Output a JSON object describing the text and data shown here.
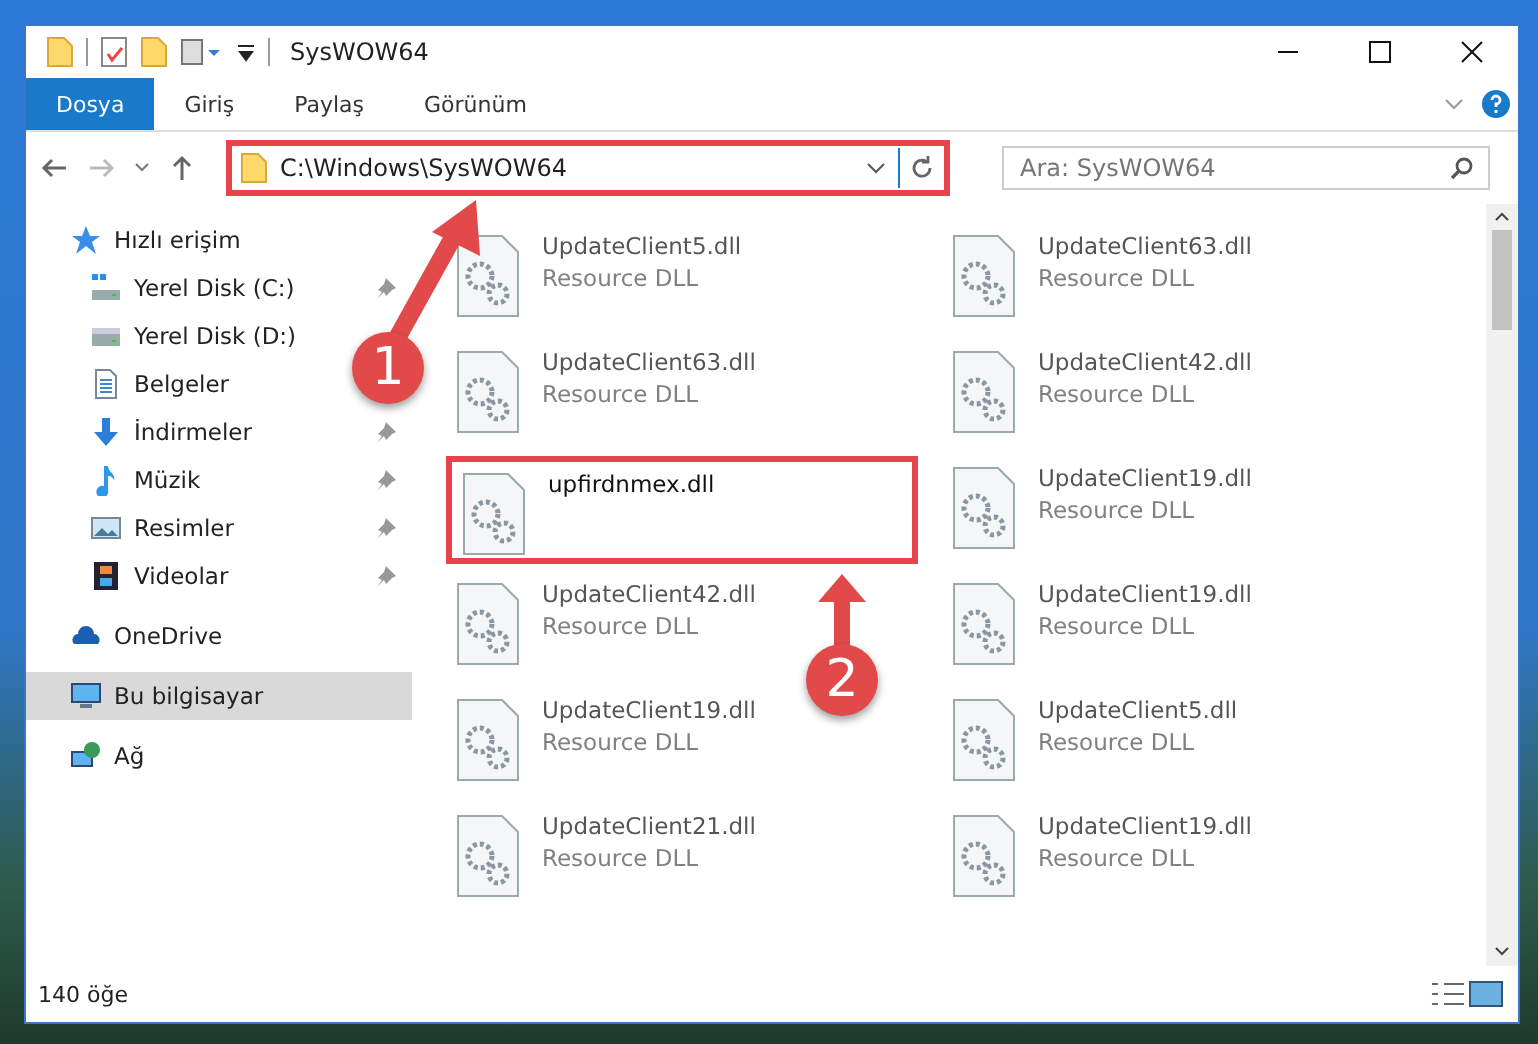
{
  "window": {
    "title": "SysWOW64"
  },
  "ribbon_tabs": [
    {
      "label": "Dosya",
      "selected": true
    },
    {
      "label": "Giriş",
      "selected": false
    },
    {
      "label": "Paylaş",
      "selected": false
    },
    {
      "label": "Görünüm",
      "selected": false
    }
  ],
  "address_bar": {
    "path": "C:\\Windows\\SysWOW64",
    "highlighted": true
  },
  "search": {
    "placeholder": "Ara: SysWOW64"
  },
  "sidebar": {
    "items": [
      {
        "label": "Hızlı erişim",
        "kind": "star",
        "selected": false,
        "children": [
          {
            "label": "Yerel Disk (C:)",
            "kind": "windrive",
            "pinned": true,
            "selected": false
          },
          {
            "label": "Yerel Disk (D:)",
            "kind": "drive",
            "pinned": false,
            "selected": false
          },
          {
            "label": "Belgeler",
            "kind": "document",
            "pinned": false,
            "selected": false
          },
          {
            "label": "İndirmeler",
            "kind": "download",
            "pinned": true,
            "selected": false
          },
          {
            "label": "Müzik",
            "kind": "music",
            "pinned": true,
            "selected": false
          },
          {
            "label": "Resimler",
            "kind": "pictures",
            "pinned": true,
            "selected": false
          },
          {
            "label": "Videolar",
            "kind": "video",
            "pinned": true,
            "selected": false
          }
        ]
      },
      {
        "label": "OneDrive",
        "kind": "cloud",
        "selected": false
      },
      {
        "label": "Bu bilgisayar",
        "kind": "computer",
        "selected": true
      },
      {
        "label": "Ağ",
        "kind": "network",
        "selected": false
      }
    ]
  },
  "files": [
    {
      "name": "UpdateClient5.dll",
      "type": "Resource DLL",
      "highlighted": false
    },
    {
      "name": "UpdateClient63.dll",
      "type": "Resource DLL",
      "highlighted": false
    },
    {
      "name": "UpdateClient63.dll",
      "type": "Resource DLL",
      "highlighted": false
    },
    {
      "name": "UpdateClient42.dll",
      "type": "Resource DLL",
      "highlighted": false
    },
    {
      "name": "upfirdnmex.dll",
      "highlighted": true
    },
    {
      "name": "UpdateClient19.dll",
      "type": "Resource DLL",
      "highlighted": false
    },
    {
      "name": "UpdateClient42.dll",
      "type": "Resource DLL",
      "highlighted": false
    },
    {
      "name": "UpdateClient19.dll",
      "type": "Resource DLL",
      "highlighted": false
    },
    {
      "name": "UpdateClient19.dll",
      "type": "Resource DLL",
      "highlighted": false
    },
    {
      "name": "UpdateClient5.dll",
      "type": "Resource DLL",
      "highlighted": false
    },
    {
      "name": "UpdateClient21.dll",
      "type": "Resource DLL",
      "highlighted": false
    },
    {
      "name": "UpdateClient19.dll",
      "type": "Resource DLL",
      "highlighted": false
    }
  ],
  "status_bar": {
    "count": "140 öğe"
  },
  "callouts": [
    {
      "number": "1"
    },
    {
      "number": "2"
    }
  ]
}
